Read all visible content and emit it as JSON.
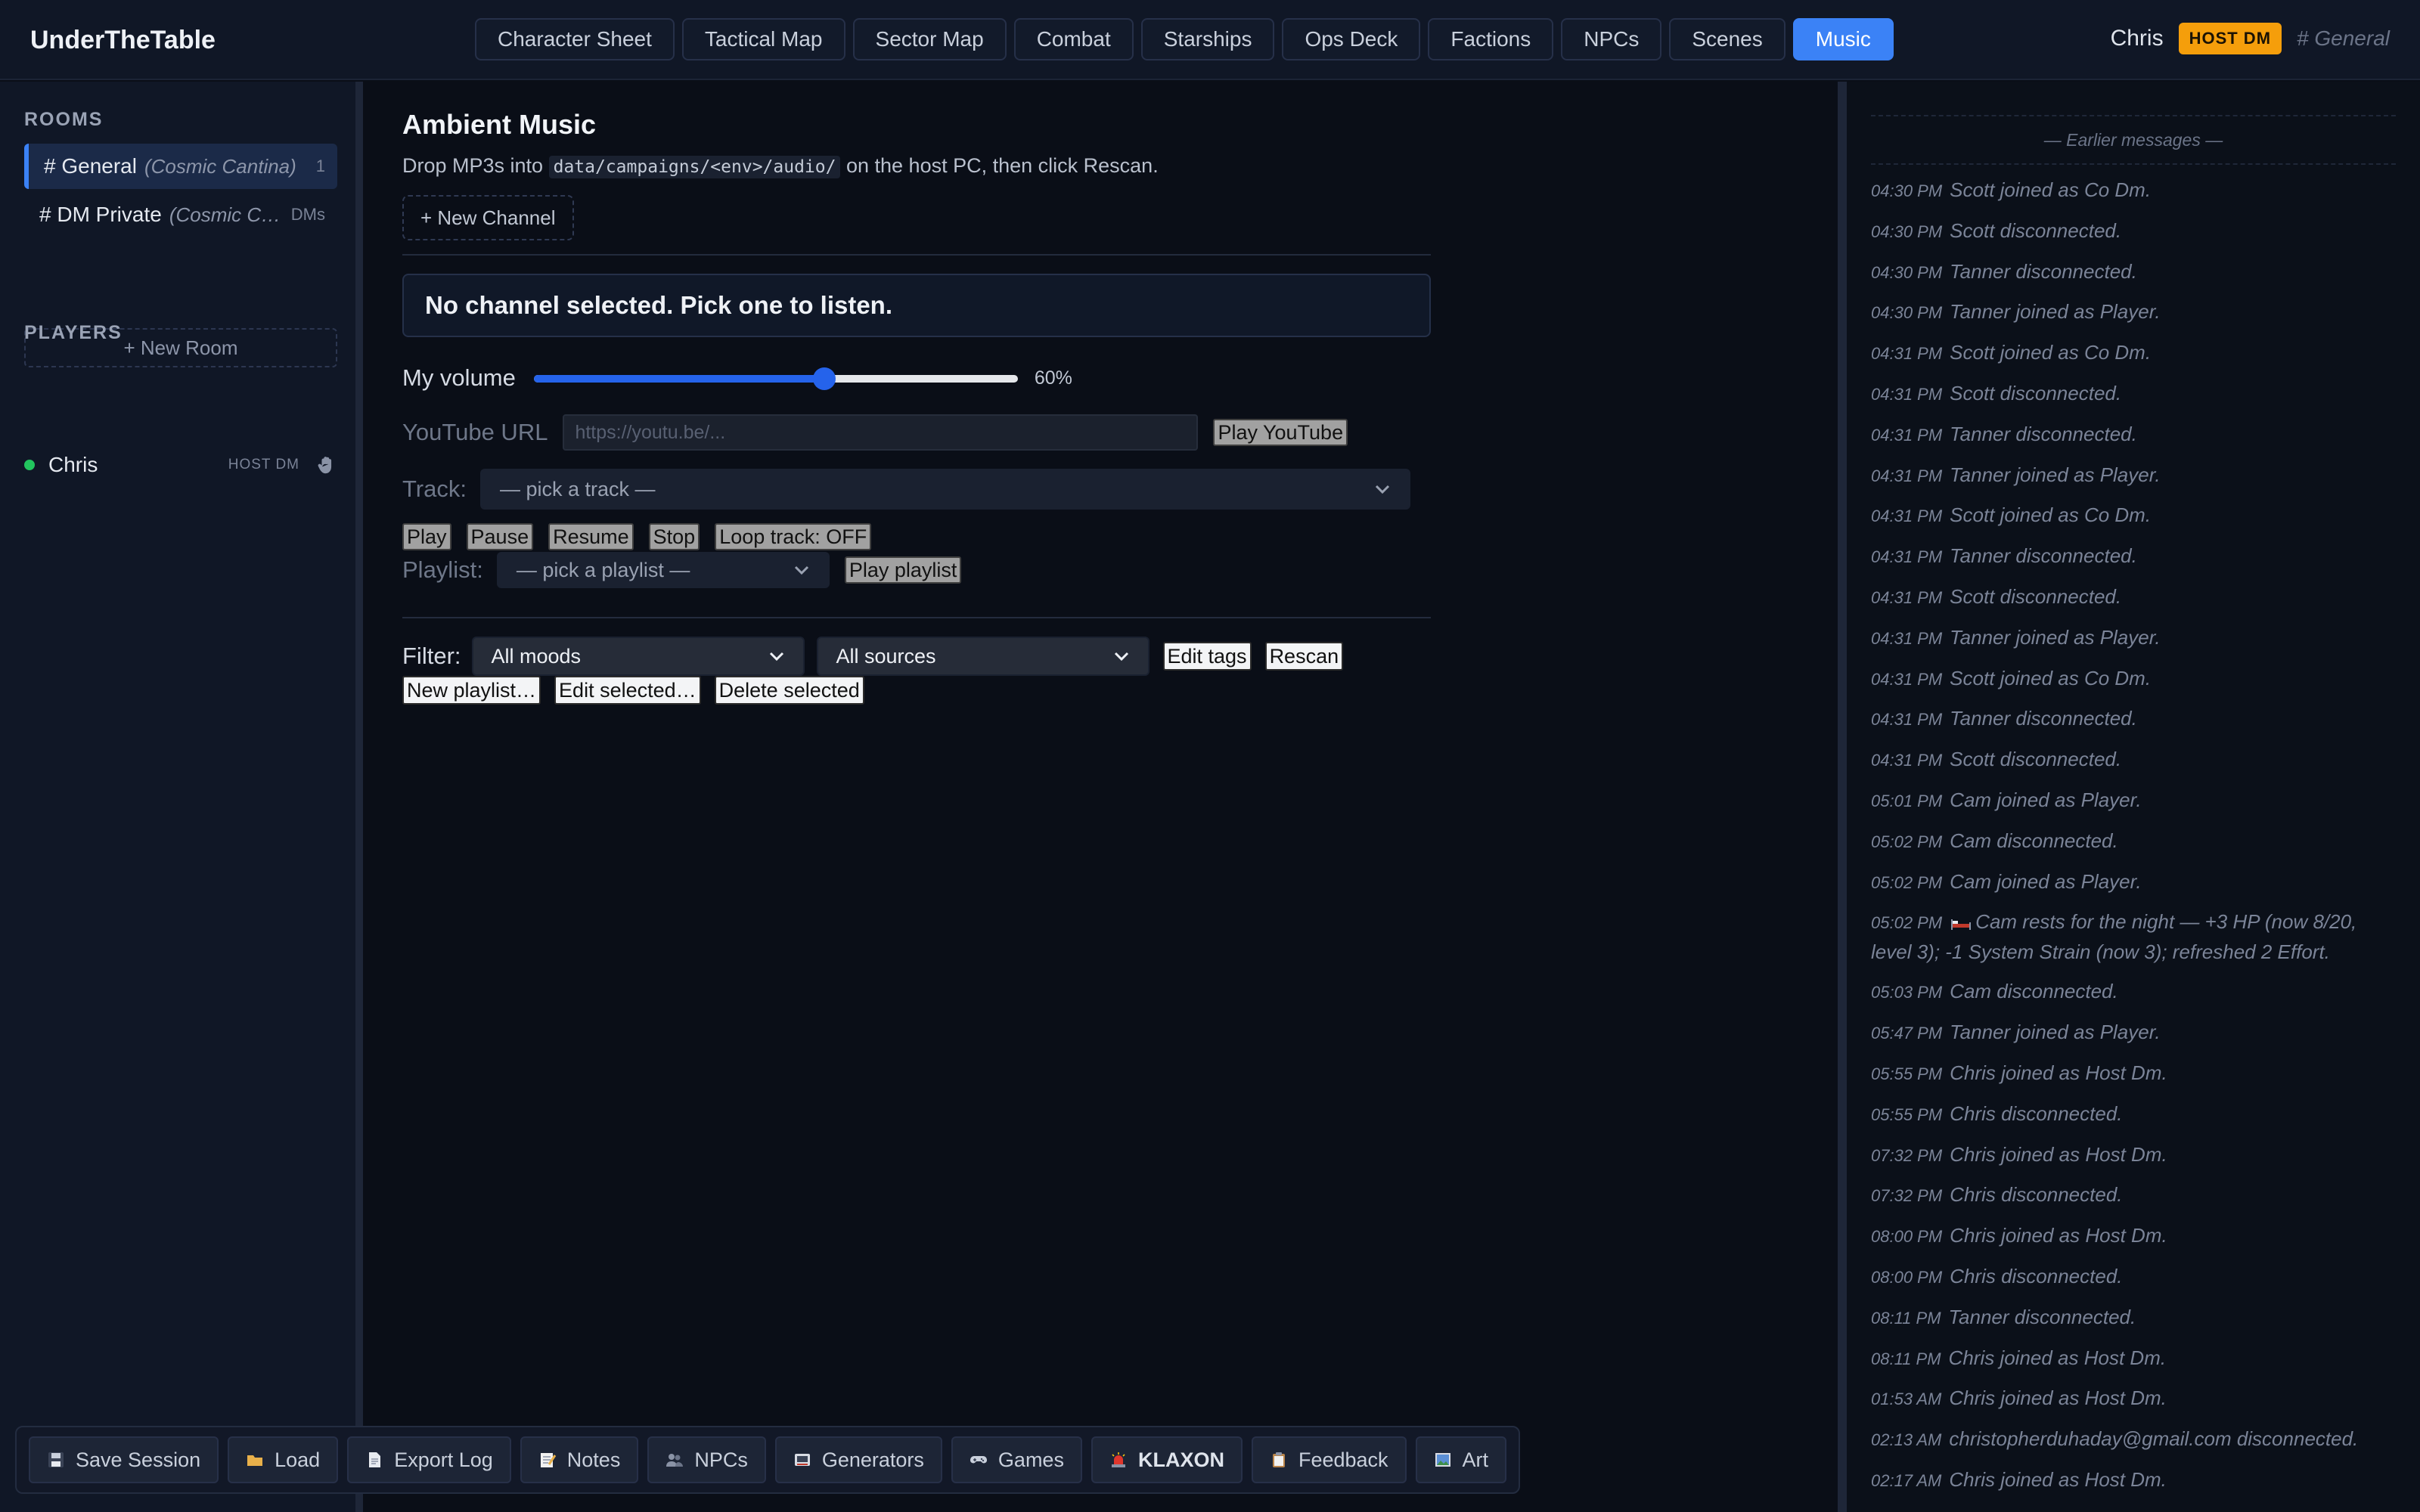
{
  "app": {
    "brand": "UnderTheTable"
  },
  "nav": {
    "tabs": [
      {
        "label": "Character Sheet"
      },
      {
        "label": "Tactical Map"
      },
      {
        "label": "Sector Map"
      },
      {
        "label": "Combat"
      },
      {
        "label": "Starships"
      },
      {
        "label": "Ops Deck"
      },
      {
        "label": "Factions"
      },
      {
        "label": "NPCs"
      },
      {
        "label": "Scenes"
      },
      {
        "label": "Music"
      }
    ],
    "active_tab": "Music"
  },
  "user": {
    "name": "Chris",
    "badge": "HOST DM",
    "channel": "# General"
  },
  "sidebar": {
    "rooms_title": "ROOMS",
    "rooms": [
      {
        "name": "# General",
        "env": "(Cosmic Cantina)",
        "meta": "1"
      },
      {
        "name": "# DM Private",
        "env": "(Cosmic Cantina)",
        "meta": "DMs"
      }
    ],
    "new_room": "+ New Room",
    "players_title": "PLAYERS",
    "players": [
      {
        "name": "Chris",
        "role": "HOST DM"
      }
    ]
  },
  "music": {
    "title": "Ambient Music",
    "hint_pre": "Drop MP3s into",
    "hint_path": "data/campaigns/<env>/audio/",
    "hint_post": "on the host PC, then click Rescan.",
    "new_channel": "+ New Channel",
    "notice": "No channel selected. Pick one to listen.",
    "volume_label": "My volume",
    "volume_percent": 60,
    "volume_text": "60%",
    "youtube_label": "YouTube URL",
    "youtube_placeholder": "https://youtu.be/...",
    "play_youtube": "Play YouTube",
    "track_label": "Track:",
    "track_selected": "— pick a track —",
    "controls": {
      "play": "Play",
      "pause": "Pause",
      "resume": "Resume",
      "stop": "Stop",
      "loop": "Loop track: OFF"
    },
    "playlist_label": "Playlist:",
    "playlist_selected": "— pick a playlist —",
    "play_playlist": "Play playlist",
    "filter_label": "Filter:",
    "mood_selected": "All moods",
    "source_selected": "All sources",
    "edit_tags": "Edit tags",
    "rescan": "Rescan",
    "new_playlist": "New playlist…",
    "edit_selected": "Edit selected…",
    "delete_selected": "Delete selected"
  },
  "chat": {
    "earlier": "— Earlier messages —",
    "messages": [
      {
        "time": "04:30 PM",
        "text": "Scott joined as Co Dm."
      },
      {
        "time": "04:30 PM",
        "text": "Scott disconnected."
      },
      {
        "time": "04:30 PM",
        "text": "Tanner disconnected."
      },
      {
        "time": "04:30 PM",
        "text": "Tanner joined as Player."
      },
      {
        "time": "04:31 PM",
        "text": "Scott joined as Co Dm."
      },
      {
        "time": "04:31 PM",
        "text": "Scott disconnected."
      },
      {
        "time": "04:31 PM",
        "text": "Tanner disconnected."
      },
      {
        "time": "04:31 PM",
        "text": "Tanner joined as Player."
      },
      {
        "time": "04:31 PM",
        "text": "Scott joined as Co Dm."
      },
      {
        "time": "04:31 PM",
        "text": "Tanner disconnected."
      },
      {
        "time": "04:31 PM",
        "text": "Scott disconnected."
      },
      {
        "time": "04:31 PM",
        "text": "Tanner joined as Player."
      },
      {
        "time": "04:31 PM",
        "text": "Scott joined as Co Dm."
      },
      {
        "time": "04:31 PM",
        "text": "Tanner disconnected."
      },
      {
        "time": "04:31 PM",
        "text": "Scott disconnected."
      },
      {
        "time": "05:01 PM",
        "text": "Cam joined as Player."
      },
      {
        "time": "05:02 PM",
        "text": "Cam disconnected."
      },
      {
        "time": "05:02 PM",
        "text": "Cam joined as Player."
      },
      {
        "time": "05:02 PM",
        "text": "Cam rests for the night — +3 HP (now 8/20, level 3); -1 System Strain (now 3); refreshed 2 Effort.",
        "icon": "bed-icon"
      },
      {
        "time": "05:03 PM",
        "text": "Cam disconnected."
      },
      {
        "time": "05:47 PM",
        "text": "Tanner joined as Player."
      },
      {
        "time": "05:55 PM",
        "text": "Chris joined as Host Dm."
      },
      {
        "time": "05:55 PM",
        "text": "Chris disconnected."
      },
      {
        "time": "07:32 PM",
        "text": "Chris joined as Host Dm."
      },
      {
        "time": "07:32 PM",
        "text": "Chris disconnected."
      },
      {
        "time": "08:00 PM",
        "text": "Chris joined as Host Dm."
      },
      {
        "time": "08:00 PM",
        "text": "Chris disconnected."
      },
      {
        "time": "08:11 PM",
        "text": "Tanner disconnected."
      },
      {
        "time": "08:11 PM",
        "text": "Chris joined as Host Dm."
      },
      {
        "time": "01:53 AM",
        "text": "Chris joined as Host Dm."
      },
      {
        "time": "02:13 AM",
        "text": "christopherduhaday@gmail.com disconnected."
      },
      {
        "time": "02:17 AM",
        "text": "Chris joined as Host Dm."
      }
    ]
  },
  "toolbar": {
    "buttons": [
      {
        "label": "Save Session",
        "icon": "floppy-disk-icon"
      },
      {
        "label": "Load",
        "icon": "folder-icon"
      },
      {
        "label": "Export Log",
        "icon": "document-icon"
      },
      {
        "label": "Notes",
        "icon": "memo-icon"
      },
      {
        "label": "NPCs",
        "icon": "people-icon"
      },
      {
        "label": "Generators",
        "icon": "dice-icon"
      },
      {
        "label": "Games",
        "icon": "gamepad-icon"
      },
      {
        "label": "KLAXON",
        "icon": "siren-icon"
      },
      {
        "label": "Feedback",
        "icon": "clipboard-icon"
      },
      {
        "label": "Art",
        "icon": "picture-icon"
      }
    ]
  },
  "colors": {
    "accent": "#3b82f6",
    "badge": "#f59e0b",
    "online": "#22c55e"
  }
}
